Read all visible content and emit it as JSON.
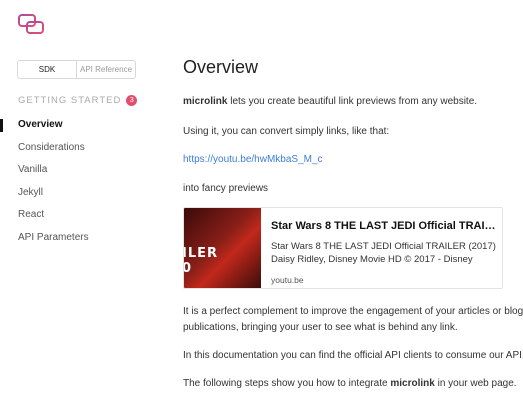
{
  "sidebar": {
    "tabs": [
      {
        "label": "SDK"
      },
      {
        "label": "API Reference"
      }
    ],
    "section": {
      "title": "GETTING STARTED",
      "badge": "3"
    },
    "items": [
      {
        "label": "Overview"
      },
      {
        "label": "Considerations"
      },
      {
        "label": "Vanilla"
      },
      {
        "label": "Jekyll"
      },
      {
        "label": "React"
      },
      {
        "label": "API Parameters"
      }
    ]
  },
  "main": {
    "title": "Overview",
    "intro_brand": "microlink",
    "intro_rest": " lets you create beautiful link previews from any website.",
    "using": "Using it, you can convert simply links, like that:",
    "example_link": "https://youtu.be/hwMkbaS_M_c",
    "into": "into fancy previews",
    "card": {
      "title": "Star Wars 8 THE LAST JEDI Official TRAIL…",
      "desc_line1": "Star Wars 8 THE LAST JEDI Official TRAILER (2017)",
      "desc_line2": "Daisy Ridley, Disney Movie HD © 2017 - Disney",
      "url": "youtu.be",
      "thumb_text_line1": "ILER",
      "thumb_text_line2": "0"
    },
    "complement_line1": "It is a perfect complement to improve the engagement of your articles or blog",
    "complement_line2": "publications, bringing your user to see what is behind any link.",
    "documentation": "In this documentation you can find the official API clients to consume our API.",
    "steps_prefix": "The following steps show you how to integrate ",
    "steps_brand": "microlink",
    "steps_suffix": " in your web page."
  },
  "colors": {
    "accent": "#e0506e",
    "link": "#3b7dd8"
  }
}
